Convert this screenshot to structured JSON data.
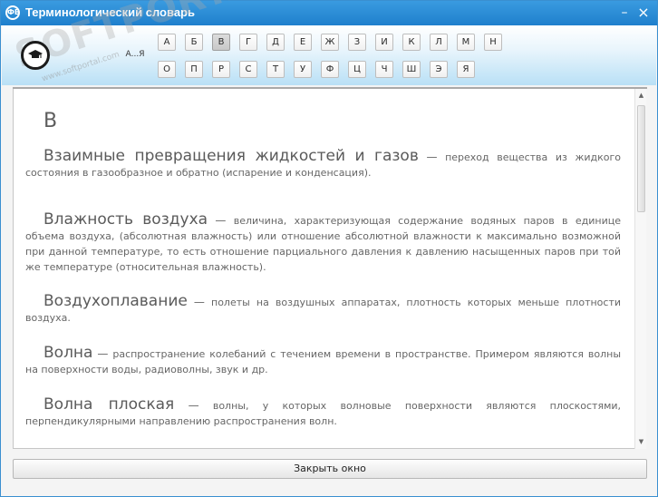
{
  "window": {
    "title": "Терминологический словарь",
    "icon_glyph": "ФВ",
    "minimize_symbol": "–",
    "close_symbol": "×"
  },
  "header": {
    "all_label": "А...Я",
    "letters_row1": [
      "А",
      "Б",
      "В",
      "Г",
      "Д",
      "Е",
      "Ж",
      "З",
      "И",
      "К",
      "Л",
      "М",
      "Н"
    ],
    "letters_row2": [
      "О",
      "П",
      "Р",
      "С",
      "Т",
      "У",
      "Ф",
      "Ц",
      "Ч",
      "Ш",
      "Э",
      "Я"
    ],
    "selected_letter": "В",
    "watermark": "SOFTPORTAL",
    "watermark_sub": "www.softportal.com"
  },
  "content": {
    "section_letter": "В",
    "entries": [
      {
        "term": "Взаимные превращения жидкостей и газов",
        "definition": "переход вещества из жидкого состояния в газообразное и обратно (испарение и конденсация)."
      },
      {
        "term": "Влажность воздуха",
        "definition": "величина, характеризующая содержание водяных паров в единице объема воздуха, (абсолютная влажность) или отношение абсолютной влажности к максимально возможной при данной температуре, то есть отношение парциального давления к давлению насыщенных паров при той же температуре (относительная влажность)."
      },
      {
        "term": "Воздухоплавание",
        "definition": "полеты на воздушных аппаратах, плотность которых меньше плотности воздуха."
      },
      {
        "term": "Волна",
        "definition": "распространение колебаний с течением времени в пространстве. Примером являются волны на поверхности воды, радиоволны, звук и др."
      },
      {
        "term": "Волна плоская",
        "definition": "волны, у которых волновые поверхности являются плоскостями, перпендикулярными направлению распространения волн."
      }
    ],
    "dash": "—"
  },
  "footer": {
    "close_label": "Закрыть окно"
  }
}
